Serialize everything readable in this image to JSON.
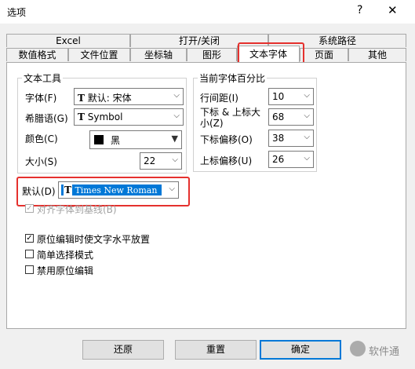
{
  "window": {
    "title": "选项",
    "help": "?",
    "close": "✕"
  },
  "tabs_row1": [
    "Excel",
    "打开/关闭",
    "系统路径"
  ],
  "tabs_row2": [
    "数值格式",
    "文件位置",
    "坐标轴",
    "图形",
    "文本字体",
    "页面",
    "其他"
  ],
  "text_tools": {
    "legend": "文本工具",
    "font_label": "字体(F)",
    "font_value": "默认: 宋体",
    "greek_label": "希腊语(G)",
    "greek_value": "Symbol",
    "color_label": "颜色(C)",
    "color_value": "黑",
    "color_swatch": "#000000",
    "size_label": "大小(S)",
    "size_value": "22"
  },
  "font_percent": {
    "legend": "当前字体百分比",
    "line_spacing_label": "行间距(I)",
    "line_spacing_value": "10",
    "subsup_label": "下标 & 上标大小(Z)",
    "subsup_value": "68",
    "sub_offset_label": "下标偏移(O)",
    "sub_offset_value": "38",
    "sup_offset_label": "上标偏移(U)",
    "sup_offset_value": "26"
  },
  "default_font": {
    "label": "默认(D)",
    "value": "Times New Roman"
  },
  "align_baseline": {
    "label": "对齐字体到基线(B)",
    "checked": "✓"
  },
  "options": [
    {
      "label": "原位编辑时使文字水平放置",
      "mark": "✓"
    },
    {
      "label": "简单选择模式",
      "mark": ""
    },
    {
      "label": "禁用原位编辑",
      "mark": ""
    }
  ],
  "buttons": {
    "reset": "还原",
    "redo": "重置",
    "ok": "确定"
  },
  "watermark": "软件通",
  "accent": "#0078d7",
  "highlight": "#e5312e"
}
